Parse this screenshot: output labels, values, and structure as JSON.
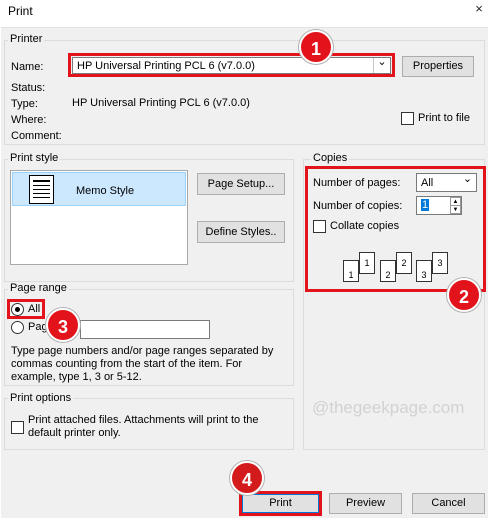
{
  "window": {
    "title": "Print"
  },
  "icons": {
    "close": "×",
    "dropdown": "⌄",
    "spin_up": "▲",
    "spin_down": "▼"
  },
  "colors": {
    "annotation_red": "#e2131b",
    "selection": "#cce8ff"
  },
  "printer": {
    "legend": "Printer",
    "name_label": "Name:",
    "name_value": "HP Universal Printing PCL 6 (v7.0.0)",
    "properties_button": "Properties",
    "status_label": "Status:",
    "type_label": "Type:",
    "type_value": "HP Universal Printing PCL 6 (v7.0.0)",
    "where_label": "Where:",
    "comment_label": "Comment:",
    "print_to_file_label": "Print to file"
  },
  "print_style": {
    "legend": "Print style",
    "style_item": "Memo Style",
    "page_setup_button": "Page Setup...",
    "define_styles_button": "Define Styles.."
  },
  "copies": {
    "legend": "Copies",
    "number_of_pages_label": "Number of pages:",
    "number_of_pages_value": "All",
    "number_of_copies_label": "Number of copies:",
    "number_of_copies_value": "1",
    "collate_label": "Collate copies",
    "collate_icons": [
      "1",
      "1",
      "2",
      "2",
      "3",
      "3"
    ]
  },
  "page_range": {
    "legend": "Page range",
    "all_label": "All",
    "pages_label": "Page",
    "help_text": "Type page numbers and/or page ranges separated by commas counting from the start of the item.  For example, type 1, 3 or 5-12."
  },
  "print_options": {
    "legend": "Print options",
    "attached_label": "Print attached files.  Attachments will print to the default printer only."
  },
  "watermark": "@thegeekpage.com",
  "buttons": {
    "print": "Print",
    "preview": "Preview",
    "cancel": "Cancel"
  },
  "annotations": [
    "1",
    "2",
    "3",
    "4"
  ]
}
